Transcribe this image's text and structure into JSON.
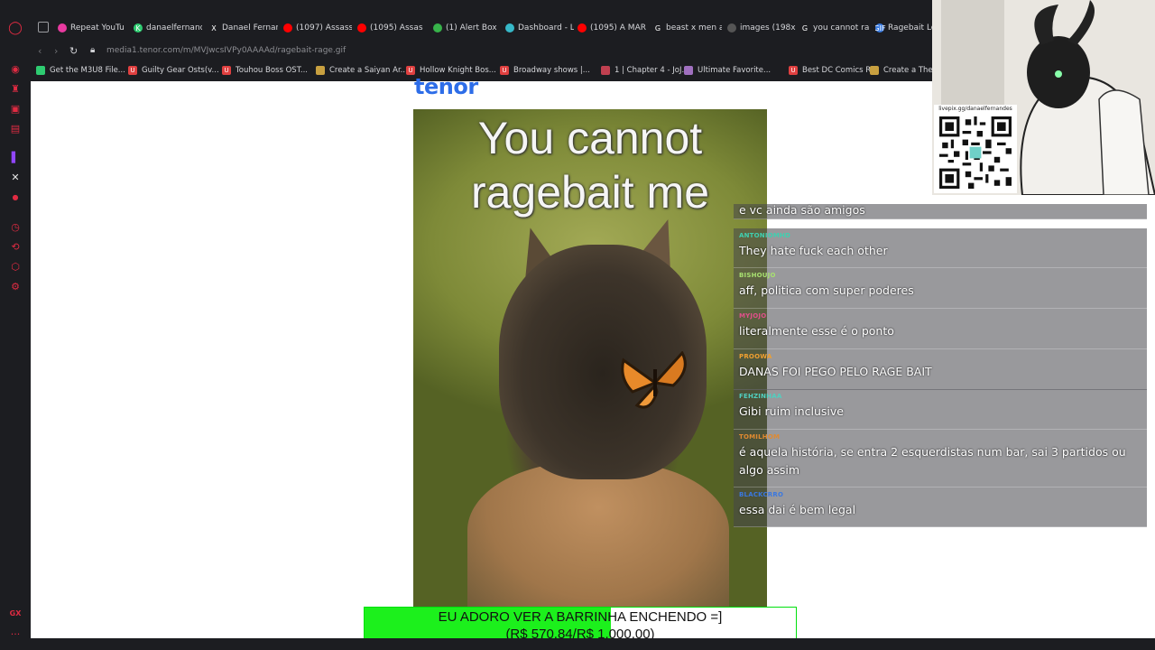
{
  "browser": {
    "tabs": [
      {
        "title": "Repeat YouTu",
        "favicon_color": "#e93aa0"
      },
      {
        "title": "danaelfernand",
        "favicon_color": "#2ecc71",
        "favicon": "K"
      },
      {
        "title": "Danael Fernan",
        "favicon_color": "#1c1d21",
        "favicon": "X"
      },
      {
        "title": "(1097) Assass",
        "favicon_color": "#ff0000"
      },
      {
        "title": "(1095) Assas",
        "favicon_color": "#ff0000"
      },
      {
        "title": "(1) Alert Box",
        "favicon_color": "#37b34a"
      },
      {
        "title": "Dashboard - L",
        "favicon_color": "#36b8c8"
      },
      {
        "title": "(1095) A MAR",
        "favicon_color": "#ff0000"
      },
      {
        "title": "beast x men a",
        "favicon_color": "#1c1d21",
        "favicon": "G"
      },
      {
        "title": "images (198x",
        "favicon_color": "#555555"
      },
      {
        "title": "you cannot ra",
        "favicon_color": "#1c1d21",
        "favicon": "G"
      },
      {
        "title": "Ragebait Lol",
        "favicon_color": "#3a7be0",
        "favicon": "GIF"
      }
    ],
    "url": "media1.tenor.com/m/MVJwcsIVPy0AAAAd/ragebait-rage.gif",
    "bookmarks": [
      {
        "label": "Get the M3U8 File...",
        "favicon_color": "#2ecc71"
      },
      {
        "label": "Guilty Gear Osts(v...",
        "favicon_color": "#e04040",
        "favicon": "U"
      },
      {
        "label": "Touhou Boss OST...",
        "favicon_color": "#e04040",
        "favicon": "U"
      },
      {
        "label": "Create a Saiyan Ar...",
        "favicon_color": "#c8a040"
      },
      {
        "label": "Hollow Knight Bos...",
        "favicon_color": "#e04040",
        "favicon": "U"
      },
      {
        "label": "Broadway shows |...",
        "favicon_color": "#e04040",
        "favicon": "U"
      },
      {
        "label": "1 | Chapter 4 - JoJ...",
        "favicon_color": "#c04050"
      },
      {
        "label": "Ultimate Favorite...",
        "favicon_color": "#a070c0"
      },
      {
        "label": "Best DC Comics R...",
        "favicon_color": "#e04040",
        "favicon": "U"
      },
      {
        "label": "Create a The U",
        "favicon_color": "#c8a040"
      }
    ]
  },
  "page": {
    "logo": "tenor",
    "gif_caption_line1": "You cannot",
    "gif_caption_line2": "ragebait me"
  },
  "chat": {
    "messages": [
      {
        "user": "",
        "user_color": "#cccccc",
        "text": "e vc ainda são amigos"
      },
      {
        "user": "ANTONIOMHD",
        "user_color": "#3fd0b0",
        "text": "They hate fuck each other"
      },
      {
        "user": "BISHOUJO",
        "user_color": "#a8e070",
        "text": "aff, politica com super poderes"
      },
      {
        "user": "MYJOJO",
        "user_color": "#e0508a",
        "text": "literalmente esse é o ponto"
      },
      {
        "user": "PROOWA",
        "user_color": "#f0a030",
        "text": "DANAS FOI PEGO PELO RAGE BAIT"
      },
      {
        "user": "FEHZINHAA",
        "user_color": "#50d0c0",
        "text": "Gibi ruim inclusive"
      },
      {
        "user": "TOMILHOM",
        "user_color": "#e08a30",
        "text": "é aquela história, se entra 2 esquerdistas num bar, sai 3 partidos ou algo assim"
      },
      {
        "user": "BLACKCRRO",
        "user_color": "#3a78e0",
        "text": "essa dai é bem legal"
      }
    ]
  },
  "stream": {
    "qr_url": "livepix.gg/danaelfernandes"
  },
  "donation_goal": {
    "label": "EU ADORO VER A BARRINHA ENCHENDO =]",
    "amount": "(R$ 570,84/R$ 1.000,00)",
    "progress": 0.5708,
    "fill_color": "#1cf01c"
  }
}
